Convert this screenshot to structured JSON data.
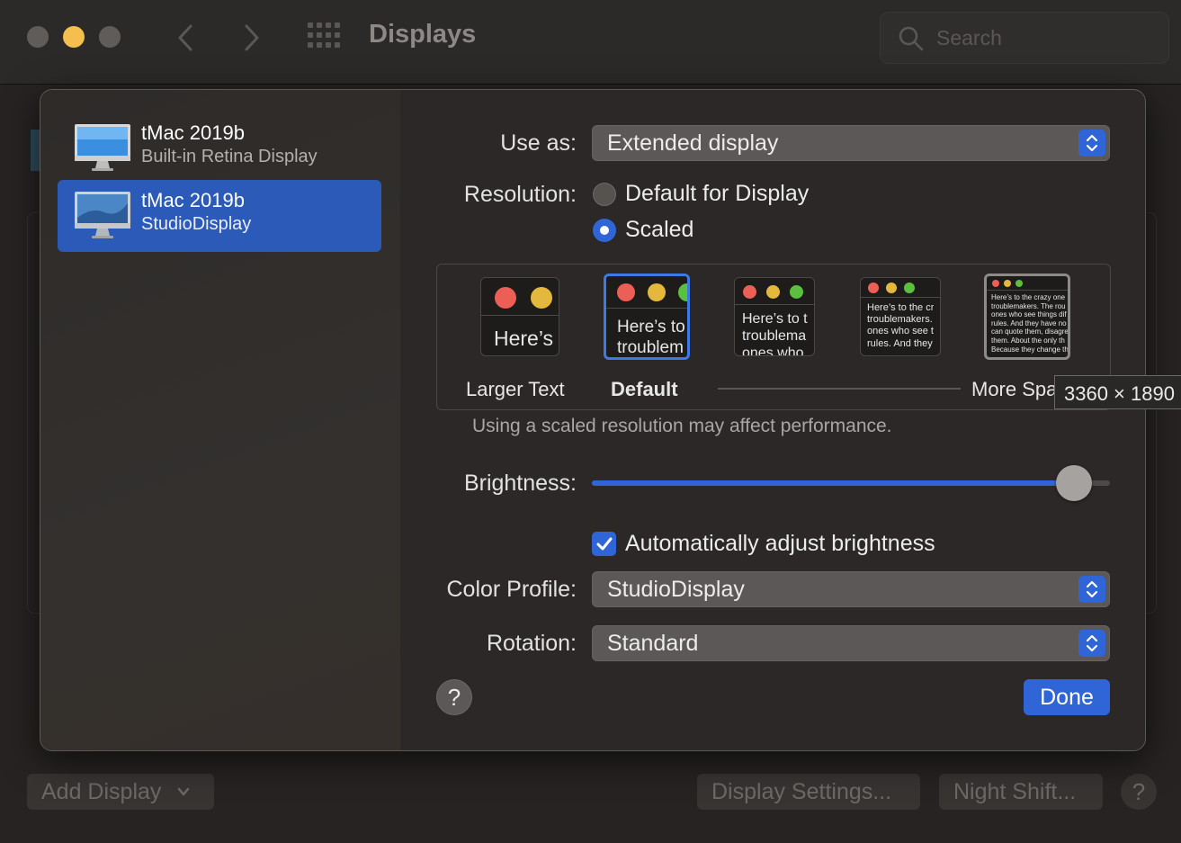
{
  "window": {
    "title": "Displays"
  },
  "search": {
    "placeholder": "Search"
  },
  "bottom_bar": {
    "add_display": "Add Display",
    "display_settings": "Display Settings...",
    "night_shift": "Night Shift...",
    "help": "?"
  },
  "displays": [
    {
      "name": "tMac 2019b",
      "subtitle": "Built-in Retina Display",
      "selected": false
    },
    {
      "name": "tMac 2019b",
      "subtitle": "StudioDisplay",
      "selected": true
    }
  ],
  "settings": {
    "use_as_label": "Use as:",
    "use_as_value": "Extended display",
    "resolution_label": "Resolution:",
    "resolution_options": [
      "Default for Display",
      "Scaled"
    ],
    "resolution_selected": "Scaled",
    "scale_options": {
      "thumb1_text": "Here’s",
      "thumb2_text": "Here’s to\ntroublem",
      "thumb3_text": "Here’s to t\ntroublema\nones who",
      "thumb4_text": "Here’s to the cr\ntroublemakers.\nones who see t\nrules. And they",
      "thumb5_text": "Here’s to the crazy one\ntroublemakers. The rou\nones who see things dif\nrules. And they have no\ncan quote them, disagre\nthem. About the only th\nBecause they change th",
      "label_larger": "Larger Text",
      "label_default": "Default",
      "label_more": "More Spa",
      "tooltip": "3360 × 1890"
    },
    "performance_note": "Using a scaled resolution may affect performance.",
    "brightness_label": "Brightness:",
    "brightness_value": 0.93,
    "auto_brightness_label": "Automatically adjust brightness",
    "auto_brightness_checked": true,
    "color_profile_label": "Color Profile:",
    "color_profile_value": "StudioDisplay",
    "rotation_label": "Rotation:",
    "rotation_value": "Standard",
    "help": "?",
    "done": "Done"
  },
  "colors": {
    "accent": "#2f65d6",
    "traffic_yellow": "#f4bf4f",
    "dot_red": "#ec5f56",
    "dot_yellow": "#e3b83d",
    "dot_green": "#5cc03f"
  },
  "icons": {
    "back": "chevron-left-icon",
    "forward": "chevron-right-icon",
    "grid": "grid-icon",
    "search": "magnifier-icon",
    "monitor": "imac-icon",
    "stepper": "up-down-chevron-icon",
    "checkmark": "checkmark-icon"
  }
}
